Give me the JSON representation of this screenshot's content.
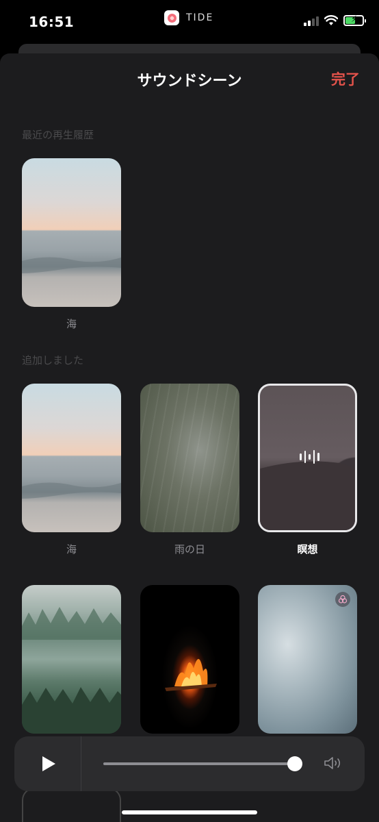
{
  "status_bar": {
    "time": "16:51",
    "app_name": "TIDE",
    "accent": "#f36d7a"
  },
  "sheet": {
    "title": "サウンドシーン",
    "done_label": "完了",
    "done_color": "#e5534b",
    "background": "#1c1c1e"
  },
  "recent": {
    "label": "最近の再生履歴",
    "items": [
      {
        "name": "海",
        "scene": "sea"
      }
    ]
  },
  "added": {
    "label": "追加しました",
    "items": [
      {
        "name": "海",
        "scene": "sea",
        "selected": false
      },
      {
        "name": "雨の日",
        "scene": "rain",
        "selected": false
      },
      {
        "name": "瞑想",
        "scene": "meditation",
        "selected": true,
        "icon": "waveform-icon"
      },
      {
        "name": "",
        "scene": "forest",
        "selected": false
      },
      {
        "name": "",
        "scene": "fire",
        "selected": false
      },
      {
        "name": "",
        "scene": "abstract",
        "selected": false,
        "icon": "mix-badge-icon"
      }
    ]
  },
  "player": {
    "play_icon": "play-icon",
    "volume_icon": "speaker-icon",
    "volume_level": 1.0
  }
}
